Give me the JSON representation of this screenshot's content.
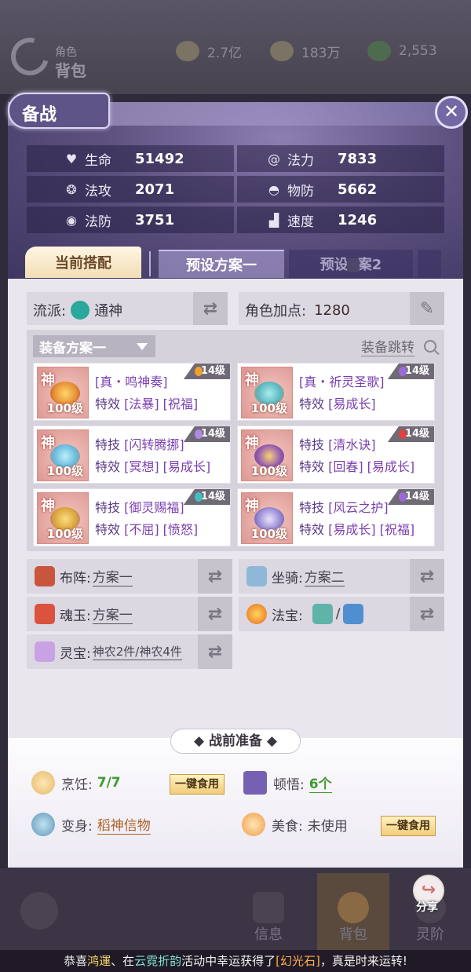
{
  "background": {
    "title_small": "角色",
    "title": "背包",
    "currencies": [
      {
        "icon": "coin-icon",
        "value": "2.7亿"
      },
      {
        "icon": "gold-ingot-icon",
        "value": "183万"
      },
      {
        "icon": "jade-icon",
        "value": "2,553"
      }
    ]
  },
  "modal": {
    "title": "备战",
    "close": "✕",
    "stats": [
      {
        "name": "生命",
        "value": "51492",
        "icon": "heart-icon"
      },
      {
        "name": "法力",
        "value": "7833",
        "icon": "swirl-icon"
      },
      {
        "name": "法攻",
        "value": "2071",
        "icon": "wave-icon"
      },
      {
        "name": "物防",
        "value": "5662",
        "icon": "helmet-icon"
      },
      {
        "name": "法防",
        "value": "3751",
        "icon": "shield-eye-icon"
      },
      {
        "name": "速度",
        "value": "1246",
        "icon": "boot-icon"
      }
    ],
    "tabs": {
      "current": "当前搭配",
      "preset1": "预设方案一",
      "preset2_a": "预设",
      "preset2_b": "案2"
    }
  },
  "school": {
    "label": "流派:",
    "value": "通神"
  },
  "points": {
    "label": "角色加点:",
    "value": "1280"
  },
  "equip": {
    "plan": "装备方案一",
    "jump": "装备跳转",
    "items": [
      {
        "god": "神",
        "level": "100级",
        "badge": "14级",
        "badge_color": "#f0a030",
        "line1_key": "[真・鸣神奏]",
        "line1_rest": "",
        "line2_key": "特效",
        "line2_rest": "[法暴] [祝福]"
      },
      {
        "god": "神",
        "level": "100级",
        "badge": "14级",
        "badge_color": "#9c6ad8",
        "line1_key": "[真・祈灵圣歌]",
        "line1_rest": "",
        "line2_key": "特效",
        "line2_rest": "[易成长]"
      },
      {
        "god": "神",
        "level": "100级",
        "badge": "14级",
        "badge_color": "#b08ae0",
        "line1_key": "特技",
        "line1_rest": "[闪转腾挪]",
        "line2_key": "特效",
        "line2_rest": "[冥想] [易成长]"
      },
      {
        "god": "神",
        "level": "100级",
        "badge": "14级",
        "badge_color": "#e04040",
        "line1_key": "特技",
        "line1_rest": "[清水诀]",
        "line2_key": "特效",
        "line2_rest": "[回春] [易成长]"
      },
      {
        "god": "神",
        "level": "100级",
        "badge": "14级",
        "badge_color": "#40c0c0",
        "line1_key": "特技",
        "line1_rest": "[御灵赐福]",
        "line2_key": "特效",
        "line2_rest": "[不屈] [愤怒]"
      },
      {
        "god": "神",
        "level": "100级",
        "badge": "14级",
        "badge_color": "#9c6ad8",
        "line1_key": "特技",
        "line1_rest": "[风云之护]",
        "line2_key": "特效",
        "line2_rest": "[易成长] [祝福]"
      }
    ]
  },
  "config": {
    "formation": {
      "label": "布阵:",
      "value": "方案一"
    },
    "mount": {
      "label": "坐骑:",
      "value": "方案二"
    },
    "soul": {
      "label": "魂玉:",
      "value": "方案一"
    },
    "treasure": {
      "label": "法宝:",
      "sep": "/"
    },
    "spirit": {
      "label": "灵宝:",
      "value": "神农2件/神农4件"
    }
  },
  "prep": {
    "title": "◆ 战前准备 ◆",
    "cooking": {
      "label": "烹饪:",
      "value": "7/7",
      "button": "一键食用"
    },
    "insight": {
      "label": "顿悟:",
      "value": "6个"
    },
    "transform": {
      "label": "变身:",
      "value": "稻神信物"
    },
    "food": {
      "label": "美食:",
      "value": "未使用",
      "button": "一键食用"
    }
  },
  "bottom": {
    "nav": [
      "信息",
      "背包",
      "灵阶"
    ],
    "share": "分享",
    "ticker_pre": "恭喜",
    "ticker_name": "鸿運",
    "ticker_mid1": "、在",
    "ticker_place": "云霓折韵",
    "ticker_mid2": "活动中幸运获得了",
    "ticker_item": "[幻光石]",
    "ticker_post": "，真是时来运转!"
  }
}
